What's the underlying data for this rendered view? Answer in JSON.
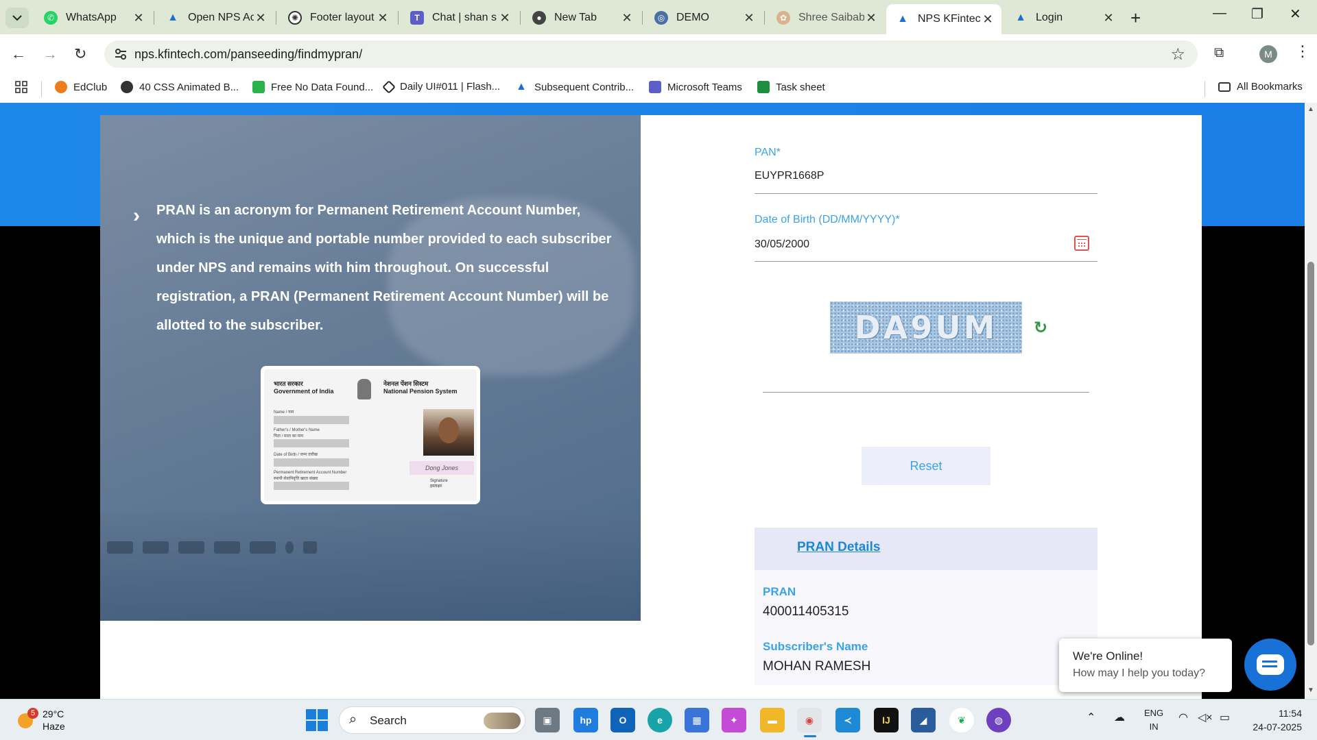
{
  "tabs": [
    {
      "title": "WhatsApp",
      "favicon": "whatsapp-icon",
      "color": "#25d366"
    },
    {
      "title": "Open NPS Ac",
      "favicon": "kfintech-icon",
      "color": "#1a6fd0"
    },
    {
      "title": "Footer layout",
      "favicon": "chatgpt-icon",
      "color": "#333333"
    },
    {
      "title": "Chat | shan s",
      "favicon": "teams-icon",
      "color": "#5b5fc7"
    },
    {
      "title": "New Tab",
      "favicon": "chrome-icon",
      "color": "#444444"
    },
    {
      "title": "DEMO",
      "favicon": "demo-icon",
      "color": "#4a6fa5"
    },
    {
      "title": "Shree Saibab",
      "favicon": "saibaba-icon",
      "color": "#d9b38c"
    },
    {
      "title": "NPS KFintech",
      "favicon": "kfintech-icon",
      "color": "#1a6fd0",
      "active": true
    },
    {
      "title": "Login",
      "favicon": "kfintech-icon",
      "color": "#1a6fd0"
    }
  ],
  "address": {
    "url": "nps.kfintech.com/panseeding/findmypran/"
  },
  "profile": {
    "initial": "M"
  },
  "bookmarks": [
    {
      "label": "EdClub",
      "color": "#f07b1d"
    },
    {
      "label": "40 CSS Animated B...",
      "color": "#333333"
    },
    {
      "label": "Free No Data Found...",
      "color": "#2ab34a"
    },
    {
      "label": "Daily UI#011 | Flash...",
      "color": "#222222"
    },
    {
      "label": "Subsequent Contrib...",
      "color": "#1a6fd0"
    },
    {
      "label": "Microsoft Teams",
      "color": "#5b5fc7"
    },
    {
      "label": "Task sheet",
      "color": "#1e8e3e"
    }
  ],
  "all_bookmarks": "All Bookmarks",
  "info": {
    "text": "PRAN is an acronym for Permanent Retirement Account Number, which is the unique and portable number provided to each subscriber under NPS and remains with him throughout. On successful registration, a PRAN (Permanent Retirement Account Number) will be allotted to the subscriber."
  },
  "pran_card": {
    "left_hi": "भारत सरकार",
    "left_en": "Government of India",
    "right_hi": "नेशनल पेंशन सिस्टम",
    "right_en": "National Pension System",
    "f_name": "Name / नाम",
    "f_parent": "Father's / Mother's Name",
    "f_parent_hi": "पिता / माता का नाम",
    "f_dob": "Date of Birth / जन्म तारीख",
    "f_pran": "Permanent Retirement Account Number",
    "f_pran_hi": "स्थायी सेवानिवृत्ति खाता संख्या",
    "signature": "Dong Jones",
    "sig_label": "Signature",
    "sig_label_hi": "हस्ताक्षर"
  },
  "form": {
    "pan_label": "PAN*",
    "pan_value": "EUYPR1668P",
    "dob_label": "Date of Birth (DD/MM/YYYY)*",
    "dob_value": "30/05/2000",
    "captcha_text": "DA9UM",
    "reset_label": "Reset"
  },
  "details": {
    "heading": "PRAN Details",
    "pran_label": "PRAN",
    "pran_value": "400011405315",
    "name_label": "Subscriber's Name",
    "name_value": "MOHAN RAMESH"
  },
  "chat": {
    "title": "We're Online!",
    "subtitle": "How may I help you today?"
  },
  "taskbar": {
    "weather_badge": "5",
    "temp": "29°C",
    "condition": "Haze",
    "search_label": "Search",
    "lang1": "ENG",
    "lang2": "IN",
    "time": "11:54",
    "date": "24-07-2025"
  },
  "colors": {
    "accent": "#3aa3e8",
    "band": "#1e88e8",
    "chat": "#1771d6"
  }
}
